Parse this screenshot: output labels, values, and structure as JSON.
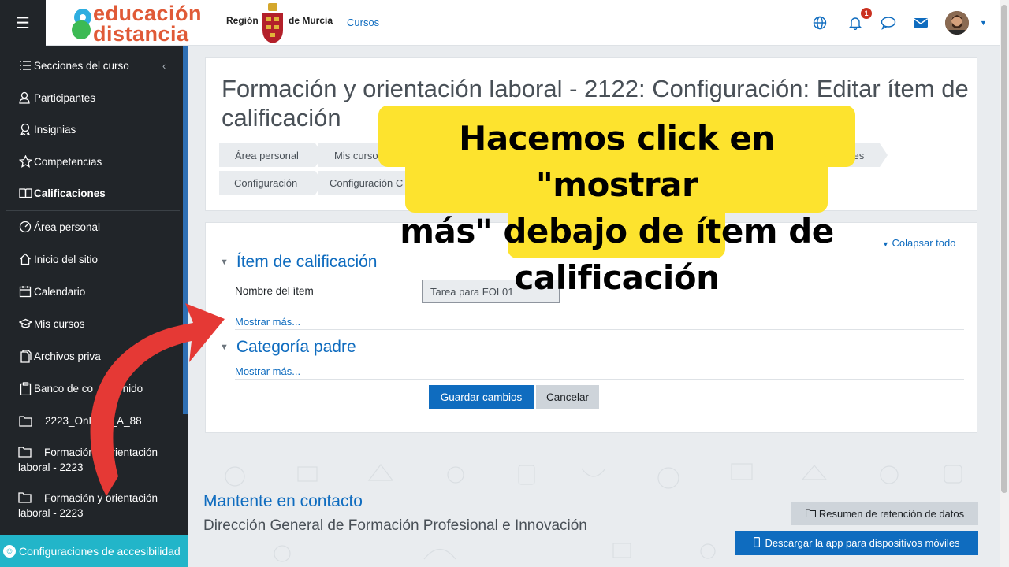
{
  "navbar": {
    "menu_icon": "hamburger-icon",
    "logo_line1": "educación",
    "logo_line2": "distancia",
    "region_text_1": "Región",
    "region_text_2": "de Murcia",
    "cursos_link": "Cursos",
    "icons": [
      "globe-icon",
      "bell-icon",
      "chat-icon",
      "envelope-icon"
    ],
    "notification_count": "1"
  },
  "sidebar": {
    "items": [
      {
        "label": "Secciones del curso",
        "icon": "list-icon"
      },
      {
        "label": "Participantes",
        "icon": "users-icon"
      },
      {
        "label": "Insignias",
        "icon": "badge-icon"
      },
      {
        "label": "Competencias",
        "icon": "star-icon"
      },
      {
        "label": "Calificaciones",
        "icon": "grades-icon"
      },
      {
        "label": "Área personal",
        "icon": "dashboard-icon"
      },
      {
        "label": "Inicio del sitio",
        "icon": "home-icon"
      },
      {
        "label": "Calendario",
        "icon": "calendar-icon"
      },
      {
        "label": "Mis cursos",
        "icon": "graduation-cap-icon"
      },
      {
        "label": "Archivos priva",
        "icon": "file-icon"
      },
      {
        "label": "Banco de co",
        "label_end": "enido",
        "icon": "clipboard-icon"
      },
      {
        "label": "2223_OnLin",
        "label_end": "_A_88",
        "icon": "folder-icon"
      }
    ],
    "courses": [
      {
        "line1": "Formación y orientación",
        "line2": "laboral - 2223"
      },
      {
        "line1": "Formación y orientación",
        "line2": "laboral - 2223"
      }
    ],
    "accessibility": "Configuraciones de accesibilidad"
  },
  "header": {
    "title": "Formación y orientación laboral - 2122: Configuración: Editar ítem de calificación",
    "breadcrumbs_row1": [
      "Área personal",
      "Mis cursos",
      "ones"
    ],
    "breadcrumbs_row2": [
      "Configuración",
      "Configuración C"
    ]
  },
  "form": {
    "collapse_all": "Colapsar todo",
    "section1_title": "Ítem de calificación",
    "item_name_label": "Nombre del ítem",
    "item_name_value": "Tarea para FOL01",
    "show_more_1": "Mostrar más...",
    "section2_title": "Categoría padre",
    "show_more_2": "Mostrar más...",
    "save_button": "Guardar cambios",
    "cancel_button": "Cancelar"
  },
  "footer": {
    "contact_title": "Mantente en contacto",
    "contact_sub": "Dirección General de Formación Profesional e Innovación",
    "retention_button": "Resumen de retención de datos",
    "app_button": "Descargar la app para dispositivos móviles"
  },
  "callout": {
    "line1": "Hacemos click en \"mostrar",
    "line2": "más\" debajo de ítem de",
    "line3": "calificación",
    "color": "#fde32e"
  },
  "colors": {
    "primary": "#0f6cbf",
    "sidebar_bg": "#212529",
    "accessibility": "#22b5c9",
    "arrow": "#e53935"
  }
}
